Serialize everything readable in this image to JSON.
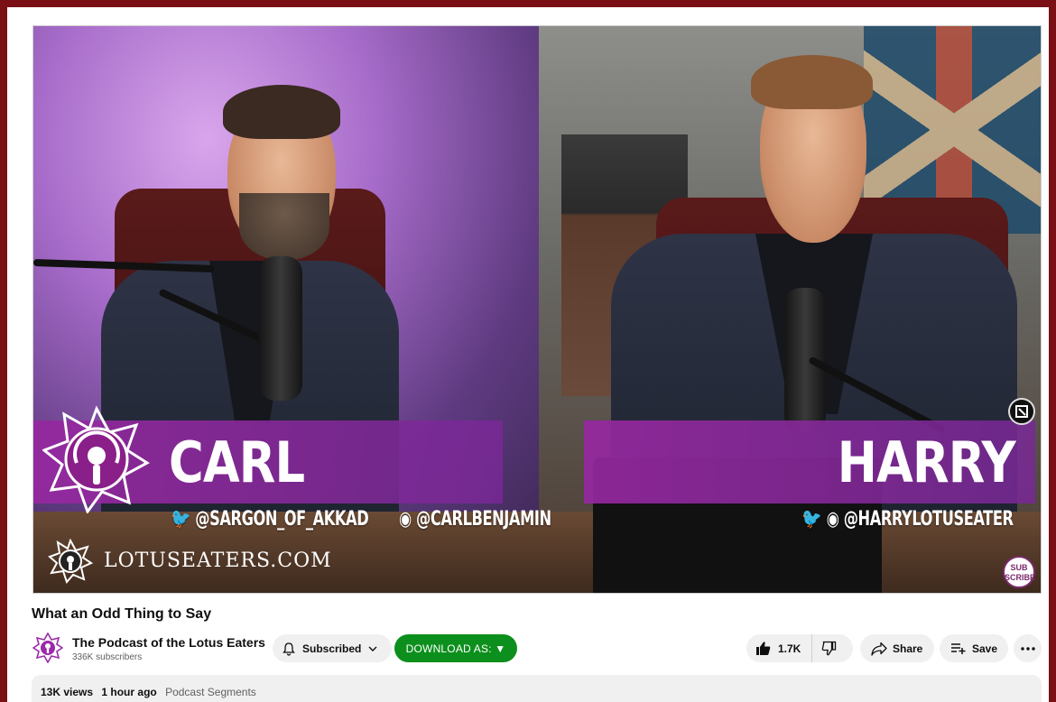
{
  "video": {
    "names": {
      "left": "CARL",
      "right": "HARRY"
    },
    "handles": {
      "left_twitter": "@SARGON_OF_AKKAD",
      "left_lotus": "@CARLBENJAMIN",
      "right_twitter": "@HARRYLOTUSEATER"
    },
    "site": "LOTUSEATERS.COM",
    "subscribe_badge": "SUB SCRIBE"
  },
  "title": "What an Odd Thing to Say",
  "channel": {
    "name": "The Podcast of the Lotus Eaters",
    "subscribers": "336K subscribers"
  },
  "actions": {
    "subscribed": "Subscribed",
    "download": "DOWNLOAD AS: ▼",
    "likes": "1.7K",
    "share": "Share",
    "save": "Save"
  },
  "description": {
    "views": "13K views",
    "age": "1 hour ago",
    "tag": "Podcast Segments"
  },
  "colors": {
    "frame": "#7a1016",
    "accent_purple": "#9a2aa8",
    "download_green": "#0c8f1c"
  },
  "icons": [
    "bell-icon",
    "chevron-down-icon",
    "thumb-up-icon",
    "thumb-down-icon",
    "share-icon",
    "playlist-add-icon",
    "more-icon",
    "podcast-icon",
    "twitter-icon",
    "lotus-icon",
    "expand-icon"
  ]
}
